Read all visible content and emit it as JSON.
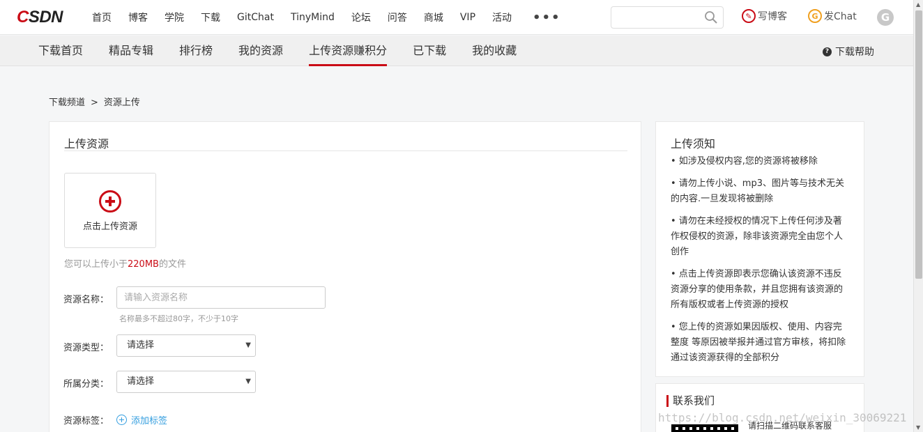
{
  "header": {
    "logo": "CSDN",
    "nav": [
      "首页",
      "博客",
      "学院",
      "下载",
      "GitChat",
      "TinyMind",
      "论坛",
      "问答",
      "商城",
      "VIP",
      "活动"
    ],
    "more": "•••",
    "search_placeholder": "",
    "write_blog": "写博客",
    "post_chat": "发Chat",
    "avatar_letter": "G"
  },
  "subnav": {
    "items": [
      "下载首页",
      "精品专辑",
      "排行榜",
      "我的资源",
      "上传资源赚积分",
      "已下载",
      "我的收藏"
    ],
    "active": "上传资源赚积分",
    "help": "下载帮助"
  },
  "breadcrumb": {
    "root": "下载频道",
    "sep": ">",
    "current": "资源上传"
  },
  "upload": {
    "title": "上传资源",
    "button_label": "点击上传资源",
    "hint_prefix": "您可以上传小于",
    "hint_size": "220MB",
    "hint_suffix": "的文件"
  },
  "form": {
    "name_label": "资源名称：",
    "name_placeholder": "请输入资源名称",
    "name_hint": "名称最多不超过80字，不少于10字",
    "type_label": "资源类型：",
    "type_value": "请选择",
    "category_label": "所属分类：",
    "category_value": "请选择",
    "tags_label": "资源标签：",
    "add_tag": "添加标签"
  },
  "notice": {
    "title": "上传须知",
    "items": [
      "• 如涉及侵权内容,您的资源将被移除",
      "• 请勿上传小说、mp3、图片等与技术无关的内容.一旦发现将被删除",
      "• 请勿在未经授权的情况下上传任何涉及著作权侵权的资源，除非该资源完全由您个人创作",
      "• 点击上传资源即表示您确认该资源不违反资源分享的使用条款，并且您拥有该资源的所有版权或者上传资源的授权",
      "• 您上传的资源如果因版权、使用、内容完整度 等原因被举报并通过官方审核，将扣除通过该资源获得的全部积分"
    ]
  },
  "contact": {
    "title": "联系我们",
    "qr_text": "请扫描二维码联系客服"
  },
  "watermark": "https://blog.csdn.net/weixin_30069221"
}
